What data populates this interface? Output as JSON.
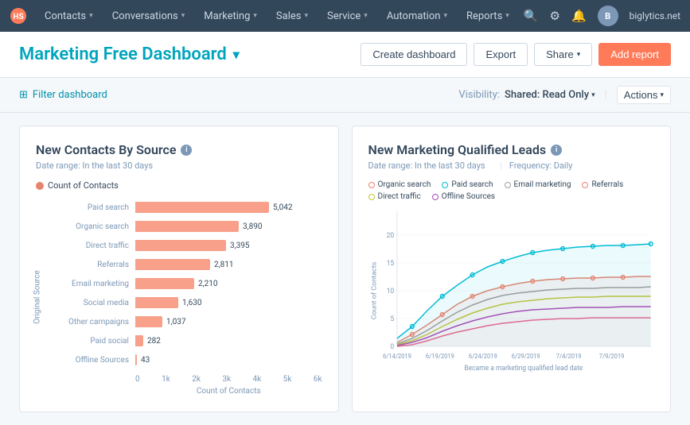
{
  "navbar": {
    "logo_text": "HS",
    "items": [
      {
        "label": "Contacts",
        "id": "contacts"
      },
      {
        "label": "Conversations",
        "id": "conversations"
      },
      {
        "label": "Marketing",
        "id": "marketing"
      },
      {
        "label": "Sales",
        "id": "sales"
      },
      {
        "label": "Service",
        "id": "service"
      },
      {
        "label": "Automation",
        "id": "automation"
      },
      {
        "label": "Reports",
        "id": "reports"
      }
    ],
    "domain": "biglytics.net"
  },
  "header": {
    "title": "Marketing Free Dashboard",
    "create_dashboard": "Create dashboard",
    "export": "Export",
    "share": "Share",
    "add_report": "Add report"
  },
  "filter_bar": {
    "filter_label": "Filter dashboard",
    "visibility_label": "Visibility:",
    "visibility_value": "Shared: Read Only",
    "actions_label": "Actions"
  },
  "chart1": {
    "title": "New Contacts By Source",
    "date_range": "Date range: In the last 30 days",
    "legend_label": "Count of Contacts",
    "y_axis_label": "Original Source",
    "x_axis_label": "Count of Contacts",
    "x_ticks": [
      "0",
      "1k",
      "2k",
      "3k",
      "4k",
      "5k",
      "6k"
    ],
    "bars": [
      {
        "label": "Paid search",
        "value": 5042,
        "display": "5,042",
        "pct": 84
      },
      {
        "label": "Organic search",
        "value": 3890,
        "display": "3,890",
        "pct": 65
      },
      {
        "label": "Direct traffic",
        "value": 3395,
        "display": "3,395",
        "pct": 57
      },
      {
        "label": "Referrals",
        "value": 2811,
        "display": "2,811",
        "pct": 47
      },
      {
        "label": "Email marketing",
        "value": 2210,
        "display": "2,210",
        "pct": 37
      },
      {
        "label": "Social media",
        "value": 1630,
        "display": "1,630",
        "pct": 27
      },
      {
        "label": "Other campaigns",
        "value": 1037,
        "display": "1,037",
        "pct": 17
      },
      {
        "label": "Paid social",
        "value": 282,
        "display": "282",
        "pct": 5
      },
      {
        "label": "Offline Sources",
        "value": 43,
        "display": "43",
        "pct": 1
      }
    ]
  },
  "chart2": {
    "title": "New Marketing Qualified Leads",
    "date_range": "Date range: In the last 30 days",
    "frequency": "Frequency: Daily",
    "y_axis_label": "Count of Contacts",
    "x_axis_label": "Became a marketing qualified lead date",
    "y_max": 20,
    "y_ticks": [
      "0",
      "5",
      "10",
      "15",
      "20"
    ],
    "x_ticks": [
      "6/14/2019",
      "6/19/2019",
      "6/24/2019",
      "6/29/2019",
      "7/4/2019",
      "7/9/2019"
    ],
    "legend": [
      {
        "label": "Organic search",
        "color": "#e8836e"
      },
      {
        "label": "Paid search",
        "color": "#00bcd4"
      },
      {
        "label": "Email marketing",
        "color": "#9e9e9e"
      },
      {
        "label": "Referrals",
        "color": "#e8836e"
      },
      {
        "label": "Direct traffic",
        "color": "#c0ca33"
      },
      {
        "label": "Offline Sources",
        "color": "#ab47bc"
      }
    ]
  }
}
